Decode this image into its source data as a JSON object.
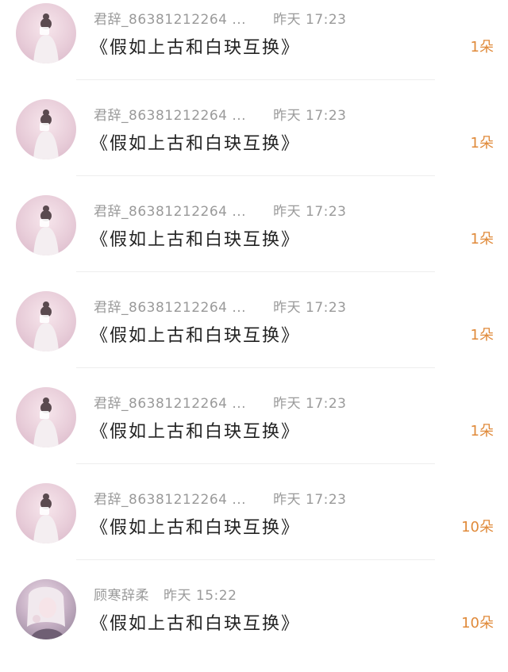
{
  "items": [
    {
      "username": "君辞_86381212264 ...",
      "time": "昨天 17:23",
      "message": "《假如上古和白玦互换》",
      "count": "1朵",
      "avatar": "avatar-girl-pink"
    },
    {
      "username": "君辞_86381212264 ...",
      "time": "昨天 17:23",
      "message": "《假如上古和白玦互换》",
      "count": "1朵",
      "avatar": "avatar-girl-pink"
    },
    {
      "username": "君辞_86381212264 ...",
      "time": "昨天 17:23",
      "message": "《假如上古和白玦互换》",
      "count": "1朵",
      "avatar": "avatar-girl-pink"
    },
    {
      "username": "君辞_86381212264 ...",
      "time": "昨天 17:23",
      "message": "《假如上古和白玦互换》",
      "count": "1朵",
      "avatar": "avatar-girl-pink"
    },
    {
      "username": "君辞_86381212264 ...",
      "time": "昨天 17:23",
      "message": "《假如上古和白玦互换》",
      "count": "1朵",
      "avatar": "avatar-girl-pink"
    },
    {
      "username": "君辞_86381212264 ...",
      "time": "昨天 17:23",
      "message": "《假如上古和白玦互换》",
      "count": "10朵",
      "avatar": "avatar-girl-pink"
    },
    {
      "username": "顾寒辞柔",
      "time": "昨天 15:22",
      "message": "《假如上古和白玦互换》",
      "count": "10朵",
      "avatar": "avatar-girl-purple"
    }
  ],
  "colors": {
    "count": "#e08a3a",
    "meta": "#9a9a9a",
    "message": "#222222"
  }
}
